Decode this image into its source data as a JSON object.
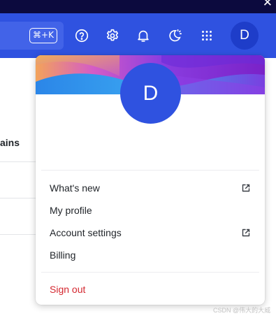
{
  "header": {
    "search_shortcut": "⌘+K",
    "profile_initial": "D",
    "icons": [
      "help-icon",
      "settings-icon",
      "bell-icon",
      "theme-icon",
      "apps-grid-icon"
    ]
  },
  "background_page": {
    "fragment_text": "ains"
  },
  "menu": {
    "avatar_initial": "D",
    "items": [
      {
        "label": "What's new",
        "external": true
      },
      {
        "label": "My profile",
        "external": false
      },
      {
        "label": "Account settings",
        "external": true
      },
      {
        "label": "Billing",
        "external": false
      }
    ],
    "sign_out": "Sign out"
  },
  "watermark": "CSDN @伟大的大威",
  "colors": {
    "header": "#2f52e0",
    "os_bar": "#0c0a3e",
    "accent_avatar": "#2f52e0",
    "sign_out": "#d4272f"
  }
}
